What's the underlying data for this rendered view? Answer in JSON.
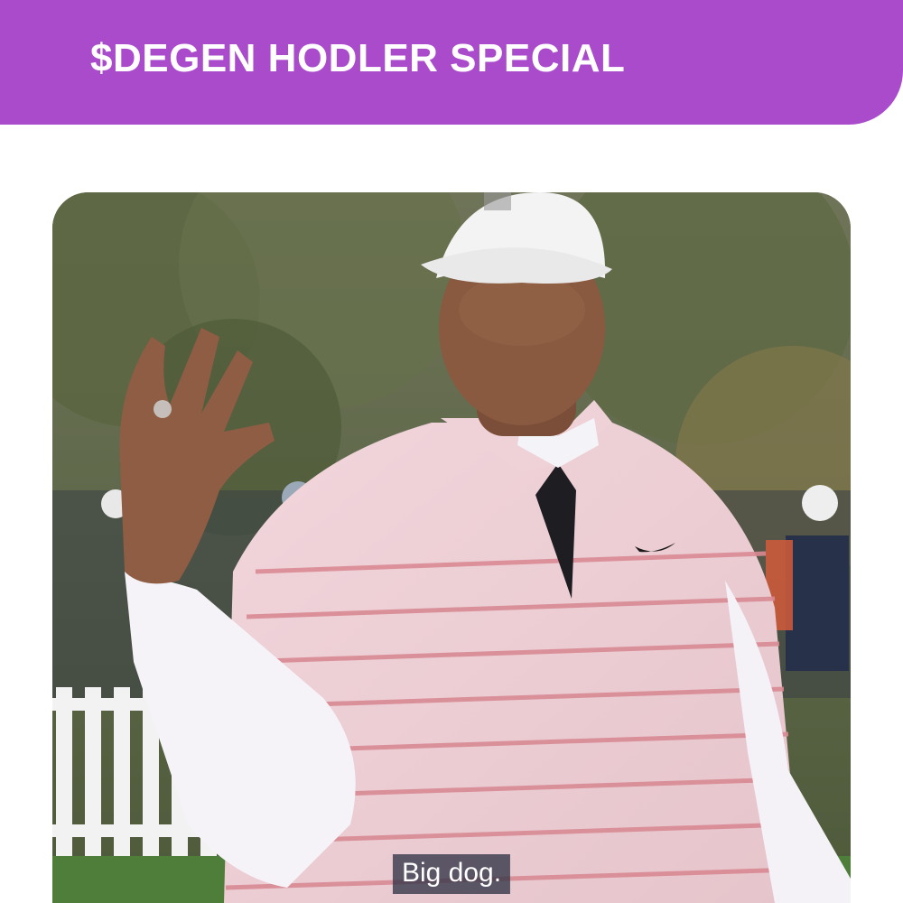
{
  "header": {
    "title": "$DEGEN HODLER SPECIAL",
    "background_color": "#a94bcb",
    "text_color": "#ffffff"
  },
  "media": {
    "caption": "Big dog."
  }
}
